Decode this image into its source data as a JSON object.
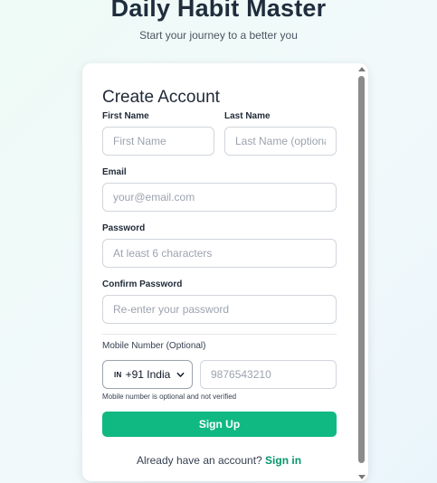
{
  "header": {
    "title": "Daily Habit Master",
    "subtitle": "Start your journey to a better you"
  },
  "form": {
    "title": "Create Account",
    "first_name": {
      "label": "First Name",
      "placeholder": "First Name",
      "value": ""
    },
    "last_name": {
      "label": "Last Name",
      "placeholder": "Last Name (optional)",
      "value": ""
    },
    "email": {
      "label": "Email",
      "placeholder": "your@email.com",
      "value": ""
    },
    "password": {
      "label": "Password",
      "placeholder": "At least 6 characters",
      "value": ""
    },
    "confirm_password": {
      "label": "Confirm Password",
      "placeholder": "Re-enter your password",
      "value": ""
    },
    "mobile": {
      "label": "Mobile Number (Optional)",
      "country_flag": "IN",
      "country_code": "+91 India",
      "placeholder": "9876543210",
      "hint": "Mobile number is optional and not verified"
    },
    "submit_label": "Sign Up",
    "footer_text": "Already have an account?",
    "signin_link": "Sign in"
  },
  "colors": {
    "accent": "#10b981",
    "link": "#059669"
  }
}
